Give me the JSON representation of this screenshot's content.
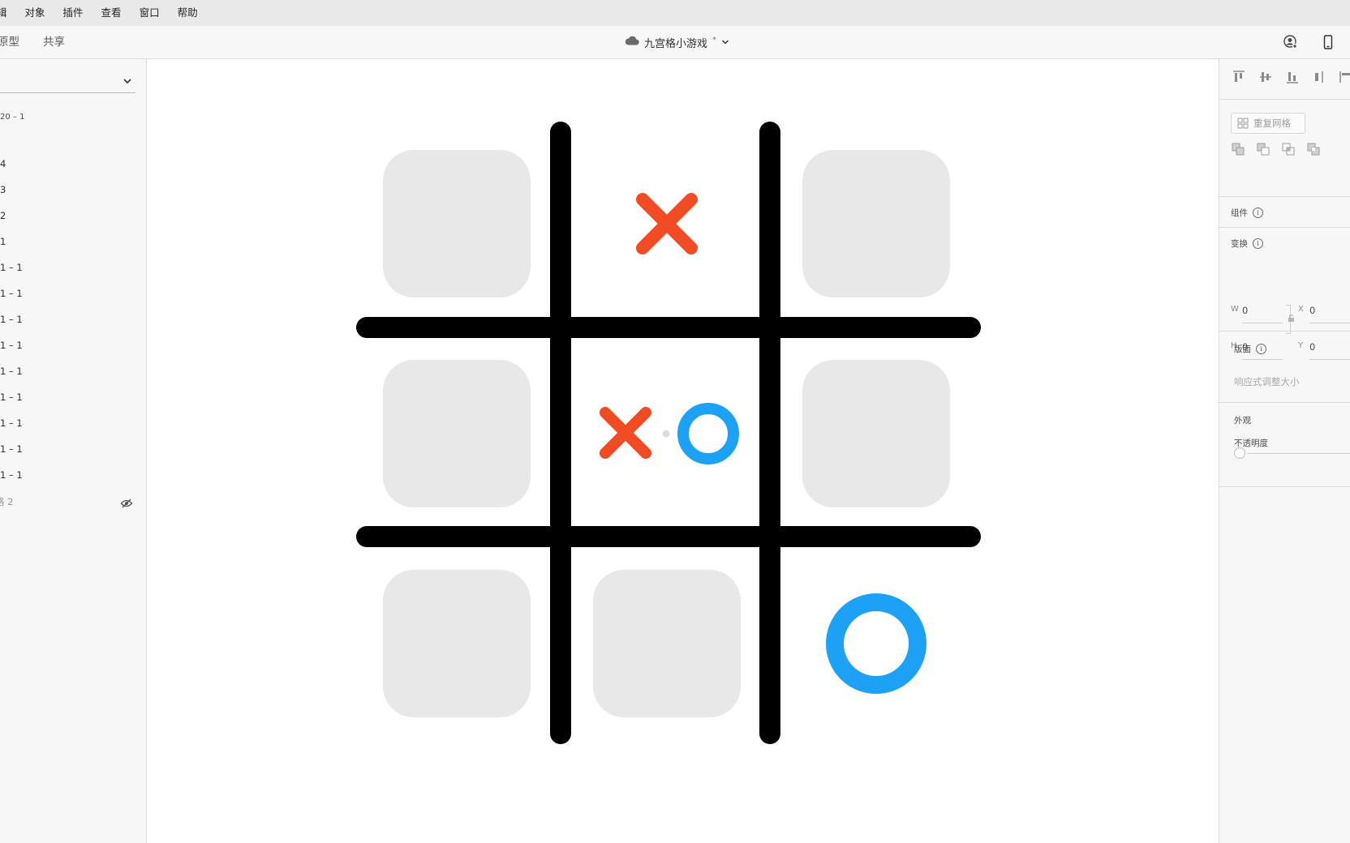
{
  "menubar": {
    "items": [
      "辑",
      "对象",
      "插件",
      "查看",
      "窗口",
      "帮助"
    ]
  },
  "titlebar": {
    "tabs": [
      "原型",
      "共享"
    ],
    "doc_title": "九宫格小游戏",
    "unsaved_mark": "*",
    "icons": [
      "cloud-icon",
      "chevron-down-icon",
      "user-share-icon",
      "mobile-preview-icon"
    ]
  },
  "layers": {
    "artboard_label": "20 – 1",
    "items": [
      "4",
      "3",
      "2",
      "1",
      "1 – 1",
      "1 – 1",
      "1 – 1",
      "1 – 1",
      "1 – 1",
      "1 – 1",
      "1 – 1",
      "1 – 1",
      "1 – 1"
    ],
    "hidden_item": "格 2"
  },
  "board": {
    "cells": [
      "empty",
      "x",
      "empty",
      "empty",
      "x-o",
      "empty",
      "empty",
      "empty",
      "o"
    ],
    "colors": {
      "grid": "#000000",
      "tile": "#e8e8e8",
      "x": "#f04b23",
      "o": "#1da1f5"
    }
  },
  "inspector": {
    "repeat_grid_label": "重复网格",
    "component_label": "组件",
    "transform_label": "变换",
    "w_label": "W",
    "w_value": "0",
    "x_label": "X",
    "x_value": "0",
    "h_label": "H",
    "h_value": "0",
    "y_label": "Y",
    "y_value": "0",
    "layout_label": "版面",
    "responsive_label": "响应式调整大小",
    "appearance_label": "外观",
    "opacity_label": "不透明度"
  }
}
